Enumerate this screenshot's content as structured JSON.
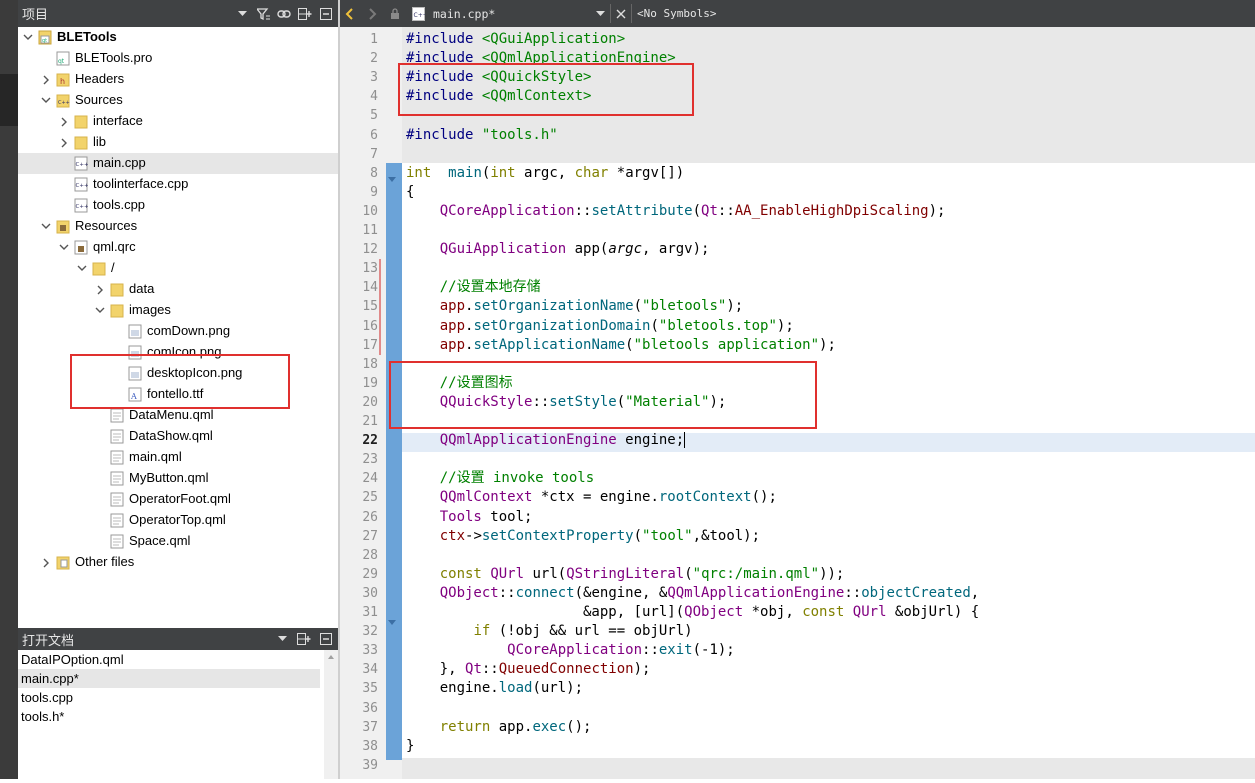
{
  "project_panel": {
    "title": "项目",
    "tree": [
      {
        "label": "BLETools",
        "depth": 0,
        "expand": "open",
        "icon": "project",
        "bold": true
      },
      {
        "label": "BLETools.pro",
        "depth": 1,
        "expand": "none",
        "icon": "pro"
      },
      {
        "label": "Headers",
        "depth": 1,
        "expand": "closed",
        "icon": "folder-h"
      },
      {
        "label": "Sources",
        "depth": 1,
        "expand": "open",
        "icon": "folder-cpp"
      },
      {
        "label": "interface",
        "depth": 2,
        "expand": "closed",
        "icon": "folder"
      },
      {
        "label": "lib",
        "depth": 2,
        "expand": "closed",
        "icon": "folder"
      },
      {
        "label": "main.cpp",
        "depth": 2,
        "expand": "none",
        "icon": "cpp",
        "selected": true
      },
      {
        "label": "toolinterface.cpp",
        "depth": 2,
        "expand": "none",
        "icon": "cpp"
      },
      {
        "label": "tools.cpp",
        "depth": 2,
        "expand": "none",
        "icon": "cpp"
      },
      {
        "label": "Resources",
        "depth": 1,
        "expand": "open",
        "icon": "folder-res"
      },
      {
        "label": "qml.qrc",
        "depth": 2,
        "expand": "open",
        "icon": "qrc"
      },
      {
        "label": "/",
        "depth": 3,
        "expand": "open",
        "icon": "folder"
      },
      {
        "label": "data",
        "depth": 4,
        "expand": "closed",
        "icon": "folder"
      },
      {
        "label": "images",
        "depth": 4,
        "expand": "open",
        "icon": "folder"
      },
      {
        "label": "comDown.png",
        "depth": 5,
        "expand": "none",
        "icon": "image"
      },
      {
        "label": "comIcon.png",
        "depth": 5,
        "expand": "none",
        "icon": "image"
      },
      {
        "label": "desktopIcon.png",
        "depth": 5,
        "expand": "none",
        "icon": "image"
      },
      {
        "label": "fontello.ttf",
        "depth": 5,
        "expand": "none",
        "icon": "font"
      },
      {
        "label": "DataMenu.qml",
        "depth": 4,
        "expand": "none",
        "icon": "qml"
      },
      {
        "label": "DataShow.qml",
        "depth": 4,
        "expand": "none",
        "icon": "qml"
      },
      {
        "label": "main.qml",
        "depth": 4,
        "expand": "none",
        "icon": "qml"
      },
      {
        "label": "MyButton.qml",
        "depth": 4,
        "expand": "none",
        "icon": "qml"
      },
      {
        "label": "OperatorFoot.qml",
        "depth": 4,
        "expand": "none",
        "icon": "qml"
      },
      {
        "label": "OperatorTop.qml",
        "depth": 4,
        "expand": "none",
        "icon": "qml"
      },
      {
        "label": "Space.qml",
        "depth": 4,
        "expand": "none",
        "icon": "qml"
      },
      {
        "label": "Other files",
        "depth": 1,
        "expand": "closed",
        "icon": "folder-other"
      }
    ]
  },
  "open_docs": {
    "title": "打开文档",
    "items": [
      {
        "label": "DataIPOption.qml"
      },
      {
        "label": "main.cpp*",
        "selected": true
      },
      {
        "label": "tools.cpp"
      },
      {
        "label": "tools.h*"
      }
    ]
  },
  "editor": {
    "file_tab": "main.cpp*",
    "symbols": "<No Symbols>",
    "current_line": 22,
    "line_numbers": [
      "1",
      "2",
      "3",
      "4",
      "5",
      "6",
      "7",
      "8",
      "9",
      "10",
      "11",
      "12",
      "13",
      "14",
      "15",
      "16",
      "17",
      "18",
      "19",
      "20",
      "21",
      "22",
      "23",
      "24",
      "25",
      "26",
      "27",
      "28",
      "29",
      "30",
      "31",
      "32",
      "33",
      "34",
      "35",
      "36",
      "37",
      "38",
      "39"
    ],
    "lines": [
      [
        [
          "p",
          "#include "
        ],
        [
          "s",
          "<QGuiApplication>"
        ]
      ],
      [
        [
          "p",
          "#include "
        ],
        [
          "s",
          "<QQmlApplicationEngine>"
        ]
      ],
      [
        [
          "p",
          "#include "
        ],
        [
          "s",
          "<QQuickStyle>"
        ]
      ],
      [
        [
          "p",
          "#include "
        ],
        [
          "s",
          "<QQmlContext>"
        ]
      ],
      [],
      [
        [
          "p",
          "#include "
        ],
        [
          "s",
          "\"tools.h\""
        ]
      ],
      [],
      [
        [
          "k",
          "int"
        ],
        [
          "",
          "  "
        ],
        [
          "f",
          "main"
        ],
        [
          "",
          "("
        ],
        [
          "k",
          "int"
        ],
        [
          "",
          " argc, "
        ],
        [
          "k",
          "char"
        ],
        [
          "",
          " *argv[])"
        ]
      ],
      [
        [
          "",
          "{"
        ]
      ],
      [
        [
          "",
          "    "
        ],
        [
          "t",
          "QCoreApplication"
        ],
        [
          "",
          "::"
        ],
        [
          "f",
          "setAttribute"
        ],
        [
          "",
          "("
        ],
        [
          "t",
          "Qt"
        ],
        [
          "",
          "::"
        ],
        [
          "m",
          "AA_EnableHighDpiScaling"
        ],
        [
          "",
          ");"
        ]
      ],
      [],
      [
        [
          "",
          "    "
        ],
        [
          "t",
          "QGuiApplication"
        ],
        [
          "",
          " app("
        ],
        [
          "it",
          "argc"
        ],
        [
          "",
          ", argv);"
        ]
      ],
      [],
      [
        [
          "",
          "    "
        ],
        [
          "c",
          "//设置本地存储"
        ]
      ],
      [
        [
          "",
          "    "
        ],
        [
          "m",
          "app"
        ],
        [
          "",
          "."
        ],
        [
          "f",
          "setOrganizationName"
        ],
        [
          "",
          "("
        ],
        [
          "s",
          "\"bletools\""
        ],
        [
          "",
          ");"
        ]
      ],
      [
        [
          "",
          "    "
        ],
        [
          "m",
          "app"
        ],
        [
          "",
          "."
        ],
        [
          "f",
          "setOrganizationDomain"
        ],
        [
          "",
          "("
        ],
        [
          "s",
          "\"bletools.top\""
        ],
        [
          "",
          ");"
        ]
      ],
      [
        [
          "",
          "    "
        ],
        [
          "m",
          "app"
        ],
        [
          "",
          "."
        ],
        [
          "f",
          "setApplicationName"
        ],
        [
          "",
          "("
        ],
        [
          "s",
          "\"bletools application\""
        ],
        [
          "",
          ");"
        ]
      ],
      [],
      [
        [
          "",
          "    "
        ],
        [
          "c",
          "//设置图标"
        ]
      ],
      [
        [
          "",
          "    "
        ],
        [
          "t",
          "QQuickStyle"
        ],
        [
          "",
          "::"
        ],
        [
          "f",
          "setStyle"
        ],
        [
          "",
          "("
        ],
        [
          "s",
          "\"Material\""
        ],
        [
          "",
          ");"
        ]
      ],
      [],
      [
        [
          "",
          "    "
        ],
        [
          "t",
          "QQmlApplicationEngine"
        ],
        [
          "",
          " engine;"
        ],
        [
          "cursor",
          ""
        ]
      ],
      [],
      [
        [
          "",
          "    "
        ],
        [
          "c",
          "//设置 invoke tools"
        ]
      ],
      [
        [
          "",
          "    "
        ],
        [
          "t",
          "QQmlContext"
        ],
        [
          "",
          " *ctx = engine."
        ],
        [
          "f",
          "rootContext"
        ],
        [
          "",
          "();"
        ]
      ],
      [
        [
          "",
          "    "
        ],
        [
          "t",
          "Tools"
        ],
        [
          "",
          " tool;"
        ]
      ],
      [
        [
          "",
          "    "
        ],
        [
          "m",
          "ctx"
        ],
        [
          "",
          "->"
        ],
        [
          "f",
          "setContextProperty"
        ],
        [
          "",
          "("
        ],
        [
          "s",
          "\"tool\""
        ],
        [
          "",
          ",&tool);"
        ]
      ],
      [],
      [
        [
          "",
          "    "
        ],
        [
          "k",
          "const"
        ],
        [
          "",
          " "
        ],
        [
          "t",
          "QUrl"
        ],
        [
          "",
          " url("
        ],
        [
          "t",
          "QStringLiteral"
        ],
        [
          "",
          "("
        ],
        [
          "s",
          "\"qrc:/main.qml\""
        ],
        [
          "",
          "));"
        ]
      ],
      [
        [
          "",
          "    "
        ],
        [
          "t",
          "QObject"
        ],
        [
          "",
          "::"
        ],
        [
          "f",
          "connect"
        ],
        [
          "",
          "(&engine, &"
        ],
        [
          "t",
          "QQmlApplicationEngine"
        ],
        [
          "",
          "::"
        ],
        [
          "f",
          "objectCreated"
        ],
        [
          "",
          ","
        ]
      ],
      [
        [
          "",
          "                     &app, [url]("
        ],
        [
          "t",
          "QObject"
        ],
        [
          "",
          " *obj, "
        ],
        [
          "k",
          "const"
        ],
        [
          "",
          " "
        ],
        [
          "t",
          "QUrl"
        ],
        [
          "",
          " &objUrl) {"
        ]
      ],
      [
        [
          "",
          "        "
        ],
        [
          "k",
          "if"
        ],
        [
          "",
          " (!obj && url == objUrl)"
        ]
      ],
      [
        [
          "",
          "            "
        ],
        [
          "t",
          "QCoreApplication"
        ],
        [
          "",
          "::"
        ],
        [
          "f",
          "exit"
        ],
        [
          "",
          "(-1);"
        ]
      ],
      [
        [
          "",
          "    }, "
        ],
        [
          "t",
          "Qt"
        ],
        [
          "",
          "::"
        ],
        [
          "m",
          "QueuedConnection"
        ],
        [
          "",
          ");"
        ]
      ],
      [
        [
          "",
          "    engine."
        ],
        [
          "f",
          "load"
        ],
        [
          "",
          "(url);"
        ]
      ],
      [],
      [
        [
          "",
          "    "
        ],
        [
          "k",
          "return"
        ],
        [
          "",
          " app."
        ],
        [
          "f",
          "exec"
        ],
        [
          "",
          "();"
        ]
      ],
      [
        [
          "",
          "}"
        ]
      ],
      []
    ]
  },
  "colors": {
    "panel_header": "#404244",
    "fold_bar": "#6ba3d8",
    "highlight_box": "#e0302e",
    "current_line": "#e3ecf7"
  }
}
